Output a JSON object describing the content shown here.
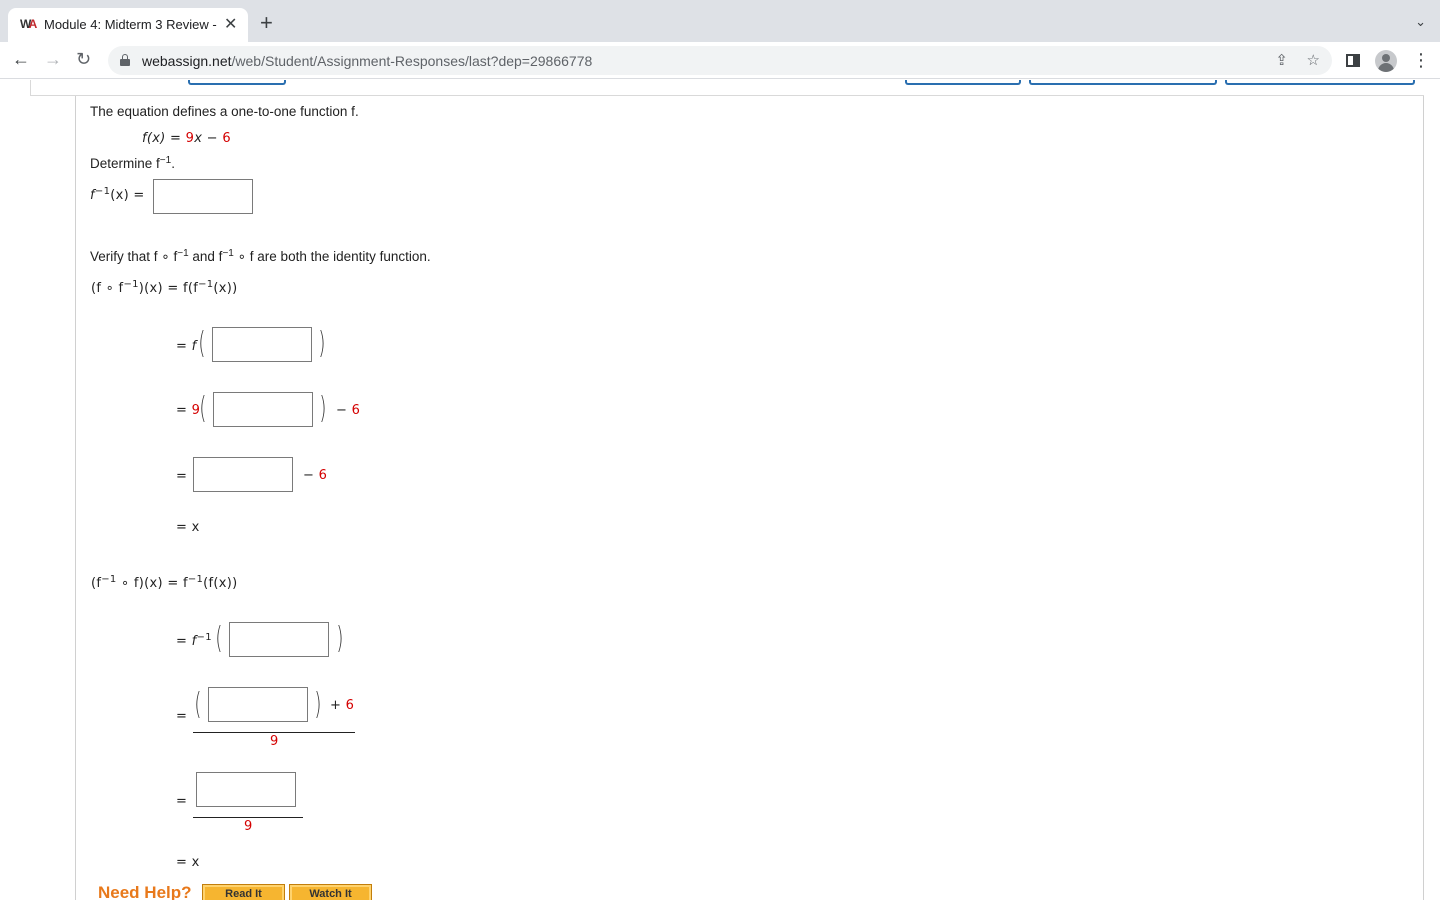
{
  "browser": {
    "tab_title": "Module 4: Midterm 3 Review -",
    "favicon_letters": [
      "W",
      "A"
    ],
    "close_symbol": "✕",
    "new_tab_symbol": "+",
    "tab_search_symbol": "⌄",
    "url_domain": "webassign.net",
    "url_path": "/web/Student/Assignment-Responses/last?dep=29866778",
    "nav": {
      "back": "←",
      "forward": "→",
      "reload": "↻"
    },
    "share_symbol": "⇪",
    "star_symbol": "☆",
    "menu_symbol": "⋮"
  },
  "problem": {
    "intro": "The equation defines a one-to-one function f.",
    "function_lhs": "f(x) = ",
    "coef": "9",
    "var": "x",
    "minus": " − ",
    "const": "6",
    "determine": "Determine f",
    "inverse_sup": "−1",
    "period": ".",
    "inverse_label": "f",
    "inverse_label_tail": "(x) =",
    "verify_a": "Verify that f ∘ f",
    "verify_b": " and f",
    "verify_c": " ∘ f are both the identity function.",
    "comp1_lhs_a": "(f ∘ f",
    "comp1_lhs_b": ")(x)  =  f(f",
    "comp1_lhs_c": "(x))",
    "eq": "=",
    "f_letter": "f",
    "plus": "+ ",
    "minus_sign": "− ",
    "x_result": "= x",
    "comp2_lhs_a": "(f",
    "comp2_lhs_b": " ∘ f)(x)  =  f",
    "comp2_lhs_c": "(f(x))",
    "denominator": "9",
    "paren_open": "(",
    "paren_close": ")"
  },
  "help": {
    "label": "Need Help?",
    "read_it": "Read It",
    "watch_it": "Watch It"
  }
}
